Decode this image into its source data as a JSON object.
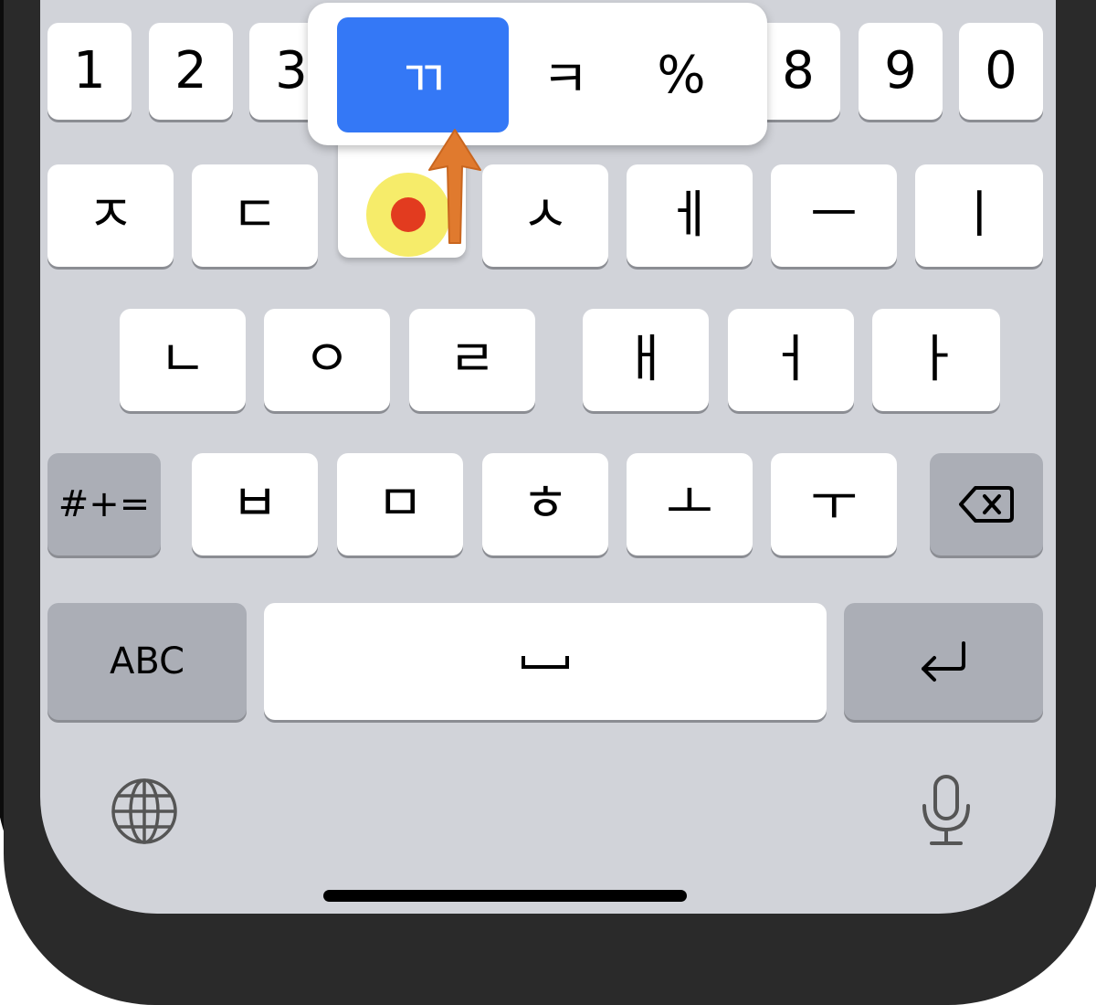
{
  "number_row": [
    "1",
    "2",
    "3",
    "8",
    "9",
    "0"
  ],
  "row1": [
    "ㅈ",
    "ㄷ",
    "ㅅ",
    "ㅔ",
    "ㅡ",
    "ㅣ"
  ],
  "row2": [
    "ㄴ",
    "ㅇ",
    "ㄹ",
    "ㅐ",
    "ㅓ",
    "ㅏ"
  ],
  "row3": {
    "symbols_label": "#+=",
    "keys": [
      "ㅂ",
      "ㅁ",
      "ㅎ",
      "ㅗ",
      "ㅜ"
    ],
    "delete_icon": "delete-backward-icon"
  },
  "bottom_row": {
    "abc_label": "ABC",
    "space_label": "␣",
    "return_icon": "return-icon"
  },
  "popup": {
    "options": [
      "ㄲ",
      "ㅋ",
      "%"
    ],
    "selected": "ㄲ"
  },
  "footer": {
    "globe_icon": "globe-icon",
    "mic_icon": "microphone-icon"
  },
  "annotation": {
    "touch_point_colors": [
      "#f6ec6a",
      "#e23b1f"
    ],
    "arrow_color": "#e07a2e"
  }
}
